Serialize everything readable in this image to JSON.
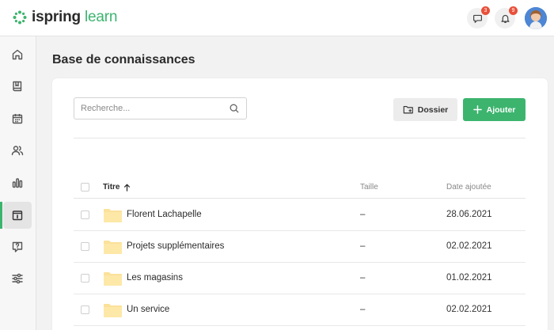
{
  "app": {
    "logo_part1": "ispring",
    "logo_part2": " learn",
    "brand_color": "#3cb46e"
  },
  "topbar": {
    "messages_badge": "3",
    "notifications_badge": "9"
  },
  "sidebar": {
    "items": [
      {
        "icon": "home-icon"
      },
      {
        "icon": "book-icon"
      },
      {
        "icon": "calendar-icon"
      },
      {
        "icon": "users-icon"
      },
      {
        "icon": "chart-icon"
      },
      {
        "icon": "knowledge-base-icon",
        "active": true
      },
      {
        "icon": "help-icon"
      },
      {
        "icon": "settings-sliders-icon"
      }
    ]
  },
  "page": {
    "title": "Base de connaissances"
  },
  "toolbar": {
    "search_placeholder": "Recherche...",
    "folder_label": "Dossier",
    "add_label": "Ajouter"
  },
  "table": {
    "columns": {
      "title": "Titre",
      "size": "Taille",
      "date": "Date ajoutée"
    },
    "sort": "title-ascending",
    "rows": [
      {
        "name": "Florent Lachapelle",
        "size": "–",
        "date": "28.06.2021"
      },
      {
        "name": "Projets supplémentaires",
        "size": "–",
        "date": "02.02.2021"
      },
      {
        "name": "Les magasins",
        "size": "–",
        "date": "01.02.2021"
      },
      {
        "name": "Un service",
        "size": "–",
        "date": "02.02.2021"
      }
    ]
  }
}
